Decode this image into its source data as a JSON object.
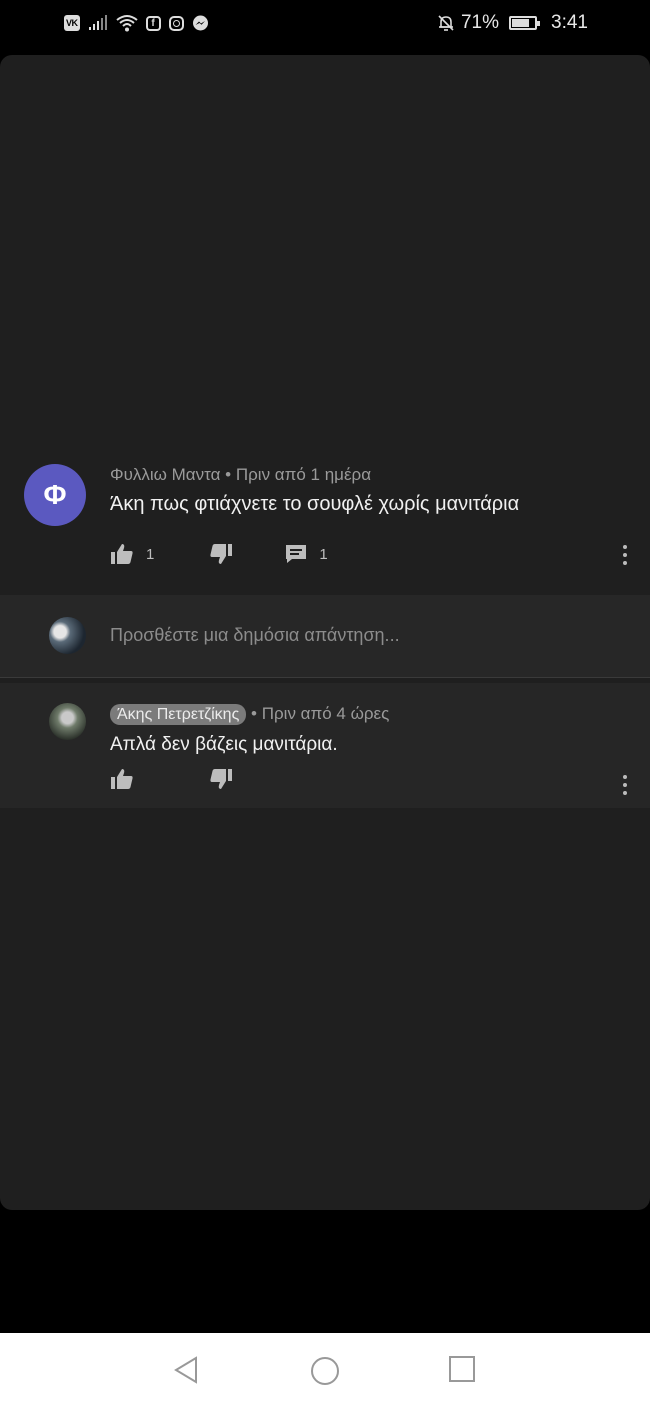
{
  "status_bar": {
    "vk_label": "VK",
    "battery": "71%",
    "time": "3:41",
    "icons": [
      "vk-icon",
      "signal-icon",
      "wifi-icon",
      "facebook-icon",
      "instagram-icon",
      "messenger-icon",
      "bell-off-icon",
      "battery-icon"
    ]
  },
  "comment": {
    "avatar_letter": "Φ",
    "author": "Φυλλιω Μαντα",
    "time": "Πριν από 1 ημέρα",
    "text": "Άκη πως φτιάχνετε το σουφλέ χωρίς μανιτάρια",
    "likes": "1",
    "replies": "1"
  },
  "reply_box": {
    "placeholder": "Προσθέστε μια δημόσια απάντηση..."
  },
  "reply": {
    "author": "Άκης Πετρετζίκης",
    "time": "Πριν από 4 ώρες",
    "text": "Απλά δεν βάζεις μανιτάρια."
  },
  "nav_bar": {
    "buttons": [
      "back-icon",
      "home-icon",
      "recents-icon"
    ]
  },
  "colors": {
    "background": "#000000",
    "panel": "#1f1f1f",
    "avatar_accent": "#5b59c0",
    "badge": "#7b7b7b"
  }
}
